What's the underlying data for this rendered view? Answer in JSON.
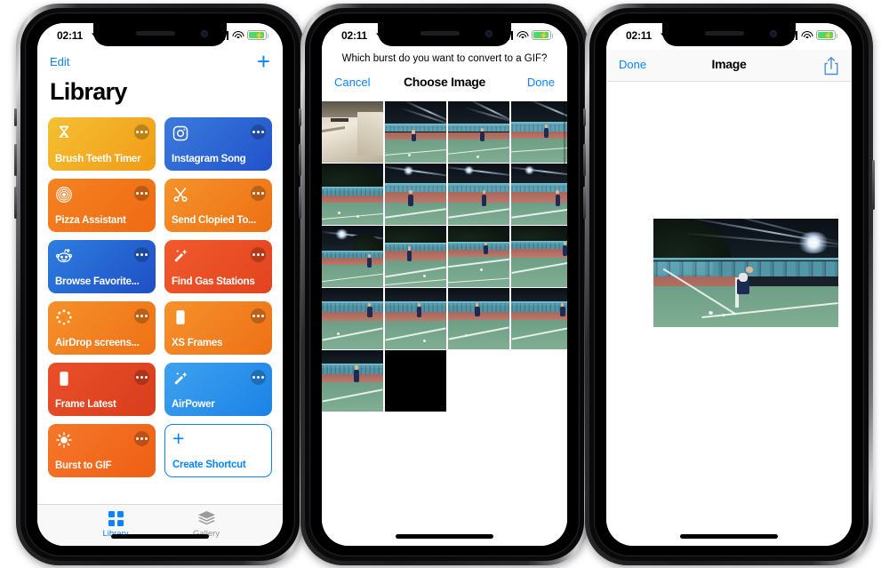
{
  "status_bar": {
    "time": "02:11",
    "location_icon": "location-arrow-icon",
    "signal_icon": "cellular-signal-icon",
    "wifi_icon": "wifi-icon",
    "battery_icon": "battery-charging-icon"
  },
  "phone1": {
    "nav": {
      "edit_label": "Edit",
      "add_icon": "plus-icon"
    },
    "title": "Library",
    "shortcuts": [
      {
        "label": "Brush Teeth Timer",
        "icon": "hourglass-icon",
        "color_start": "#f5c033",
        "color_end": "#f09b16"
      },
      {
        "label": "Instagram Song",
        "icon": "instagram-icon",
        "color_start": "#3a7bdc",
        "color_end": "#2152cb"
      },
      {
        "label": "Pizza Assistant",
        "icon": "target-icon",
        "color_start": "#f58220",
        "color_end": "#ef6a14"
      },
      {
        "label": "Send Clopied To...",
        "icon": "scissors-icon",
        "color_start": "#f5932a",
        "color_end": "#ee6f14"
      },
      {
        "label": "Browse Favorite...",
        "icon": "reddit-icon",
        "color_start": "#2d7de0",
        "color_end": "#1f4fc4"
      },
      {
        "label": "Find Gas Stations",
        "icon": "magic-wand-icon",
        "color_start": "#f15a2c",
        "color_end": "#e2431f"
      },
      {
        "label": "AirDrop screens...",
        "icon": "airdrop-icon",
        "color_start": "#f5912a",
        "color_end": "#ef7016"
      },
      {
        "label": "XS Frames",
        "icon": "phone-frame-icon",
        "color_start": "#f5922b",
        "color_end": "#ee7016"
      },
      {
        "label": "Frame Latest",
        "icon": "phone-frame-icon",
        "color_start": "#e8502a",
        "color_end": "#d93d1c"
      },
      {
        "label": "AirPower",
        "icon": "magic-wand-icon",
        "color_start": "#3fa2ef",
        "color_end": "#1b82e6"
      },
      {
        "label": "Burst to GIF",
        "icon": "brightness-icon",
        "color_start": "#f5772a",
        "color_end": "#ef5f14"
      }
    ],
    "create_shortcut": {
      "label": "Create Shortcut",
      "icon": "plus-icon",
      "border_color": "#0a84ff"
    },
    "tabs": [
      {
        "label": "Library",
        "icon": "grid-icon",
        "active": true
      },
      {
        "label": "Gallery",
        "icon": "layers-icon",
        "active": false
      }
    ]
  },
  "phone2": {
    "prompt": "Which burst do you want to convert to a GIF?",
    "nav": {
      "cancel_label": "Cancel",
      "title": "Choose Image",
      "done_label": "Done"
    },
    "thumbnails": [
      {
        "kind": "indoor-ceiling"
      },
      {
        "kind": "court-serve"
      },
      {
        "kind": "court-swing"
      },
      {
        "kind": "court-stand"
      },
      {
        "kind": "court-empty"
      },
      {
        "kind": "court-lamp-left"
      },
      {
        "kind": "court-lamp-mid"
      },
      {
        "kind": "court-lamp-right"
      },
      {
        "kind": "court-dark-left"
      },
      {
        "kind": "court-run"
      },
      {
        "kind": "court-far"
      },
      {
        "kind": "court-near"
      },
      {
        "kind": "court-wall-a"
      },
      {
        "kind": "court-wall-b"
      },
      {
        "kind": "court-wall-c"
      },
      {
        "kind": "court-wall-d"
      },
      {
        "kind": "court-last"
      },
      {
        "kind": "black"
      }
    ],
    "scrollbar_icon": "vertical-scrollbar"
  },
  "phone3": {
    "nav": {
      "done_label": "Done",
      "title": "Image",
      "share_icon": "share-icon"
    },
    "photo": {
      "alt_kind": "tennis-court-night-serve"
    }
  }
}
